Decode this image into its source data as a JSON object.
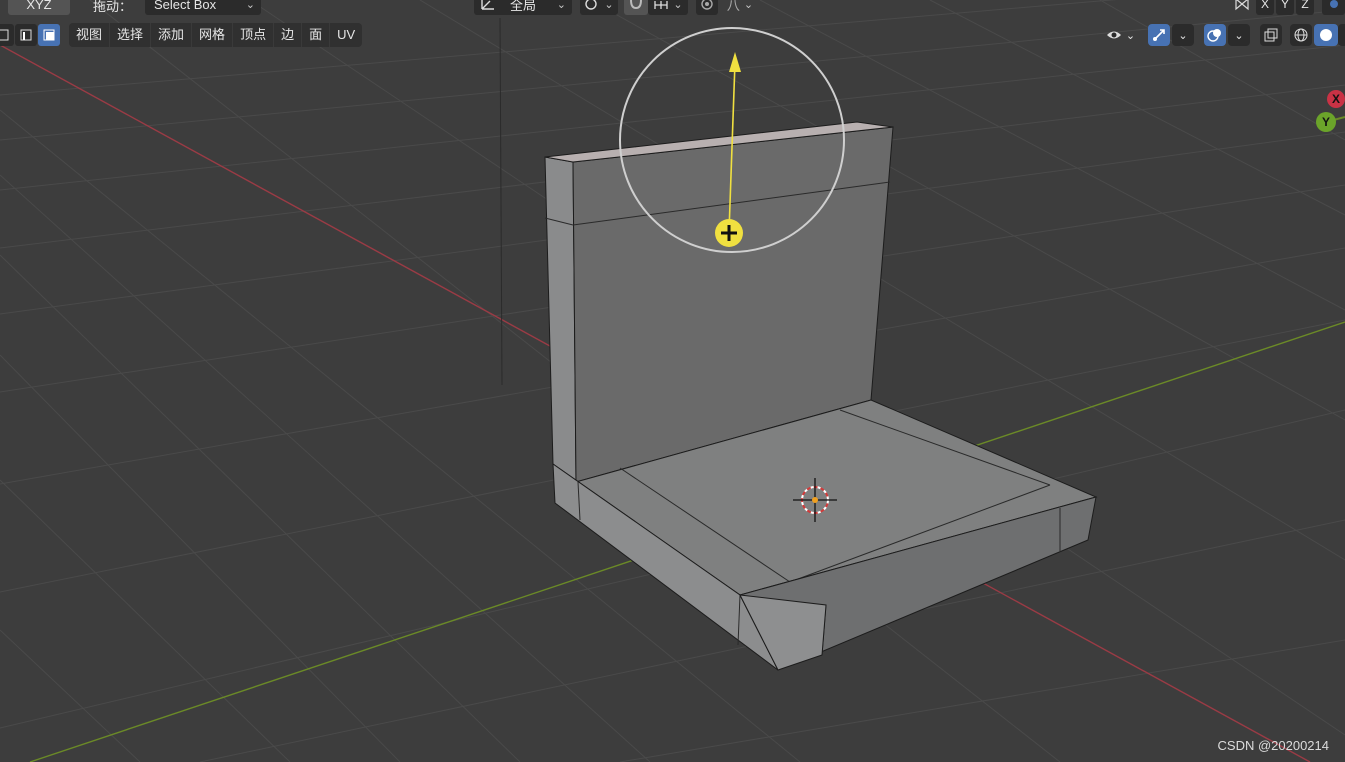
{
  "header": {
    "axis_label": "XYZ",
    "drag_label": "拖动：",
    "select_mode": "Select Box",
    "transform_orientation": "全局",
    "snap_icon": "snap-icon",
    "proportional_label": "八"
  },
  "axis_toggles": [
    "X",
    "Y",
    "Z"
  ],
  "menu": [
    "视图",
    "选择",
    "添加",
    "网格",
    "顶点",
    "边",
    "面",
    "UV"
  ],
  "gizmo": {
    "x_label": "X",
    "y_label": "Y"
  },
  "colors": {
    "background": "#3d3d3d",
    "grid": "#4a4a4a",
    "x_axis": "#9a3b45",
    "y_axis": "#6b8a27",
    "selected": "#4772b3",
    "tool_gizmo": "#f0e040"
  },
  "watermark": "CSDN @20200214"
}
